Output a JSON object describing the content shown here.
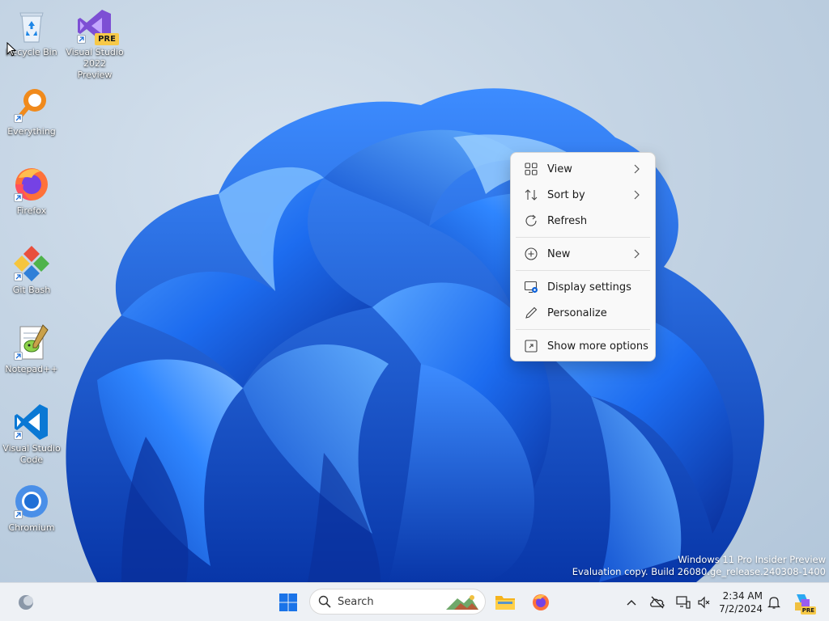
{
  "desktop_icons": [
    {
      "label": "Recycle Bin",
      "icon": "recycle-bin-icon"
    },
    {
      "label": "Visual Studio 2022 Preview",
      "line1": "Visual Studio",
      "line2": "2022 Preview",
      "badge": "PRE",
      "icon": "visual-studio-preview-icon"
    },
    {
      "label": "Everything",
      "icon": "everything-search-icon"
    },
    {
      "label": "Firefox",
      "icon": "firefox-icon"
    },
    {
      "label": "Git Bash",
      "icon": "git-bash-icon"
    },
    {
      "label": "Notepad++",
      "icon": "notepad-plus-plus-icon"
    },
    {
      "label": "Visual Studio Code",
      "line1": "Visual Studio",
      "line2": "Code",
      "icon": "vscode-icon"
    },
    {
      "label": "Chromium",
      "icon": "chromium-icon"
    }
  ],
  "context_menu": {
    "items": [
      {
        "label": "View",
        "icon": "grid-view-icon",
        "submenu": true
      },
      {
        "label": "Sort by",
        "icon": "sort-icon",
        "submenu": true
      },
      {
        "label": "Refresh",
        "icon": "refresh-icon",
        "submenu": false
      },
      {
        "label": "New",
        "icon": "plus-circle-icon",
        "submenu": true
      },
      {
        "label": "Display settings",
        "icon": "display-settings-icon",
        "submenu": false
      },
      {
        "label": "Personalize",
        "icon": "pen-icon",
        "submenu": false
      },
      {
        "label": "Show more options",
        "icon": "more-options-icon",
        "submenu": false
      }
    ]
  },
  "watermark": {
    "line1": "Windows 11 Pro Insider Preview",
    "line2": "Evaluation copy. Build 26080.ge_release.240308-1400"
  },
  "taskbar": {
    "search_label": "Search",
    "time": "2:34 AM",
    "date": "7/2/2024",
    "copilot_badge": "PRE"
  },
  "colors": {
    "accent": "#0a5fd8",
    "wallpaper_blue": "#1c6cf0",
    "wallpaper_dark": "#0a2f9a",
    "taskbar_bg": "#eef1f5",
    "menu_bg": "#f9f9f9"
  }
}
